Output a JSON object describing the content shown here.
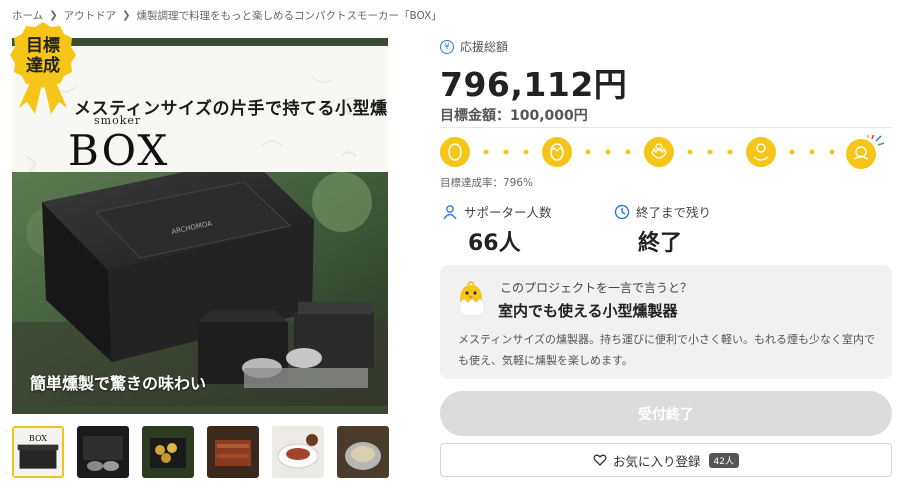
{
  "breadcrumb": {
    "items": [
      "ホーム",
      "アウトドア",
      "燻製調理で料理をもっと楽しめるコンパクトスモーカー「BOX」"
    ]
  },
  "hero": {
    "tagline": "メスティンサイズの片手で持てる小型燻製器",
    "sub": "smoker",
    "brand": "BOX",
    "product_logo": "ARCHOMOA",
    "caption": "簡単燻製で驚きの味わい",
    "badge": {
      "line1": "目標",
      "line2": "達成"
    }
  },
  "thumbnails": {
    "count": 6,
    "active_index": 0,
    "first_label": "BOX"
  },
  "funding": {
    "amount_label": "応援総額",
    "amount": "796,112円",
    "goal": "目標金額：100,000円",
    "progress_ratio": 7.96,
    "rate": "目標達成率：796%"
  },
  "stats": {
    "supporters_label": "サポーター人数",
    "supporters_value": "66人",
    "remaining_label": "終了まで残り",
    "remaining_value": "終了"
  },
  "one_say": {
    "question": "このプロジェクトを一言で言うと？",
    "title": "室内でも使える小型燻製器",
    "description": "メスティンサイズの燻製器。持ち運びに便利で小さく軽い。もれる煙も少なく室内でも使え、気軽に燻製を楽しめます。"
  },
  "actions": {
    "closed_label": "受付終了",
    "favorite_label": "お気に入り登録",
    "favorite_count": "42人"
  },
  "colors": {
    "accent_yellow": "#f5c518",
    "link_blue": "#2b7bd6",
    "dark_green": "#3b4a33"
  }
}
